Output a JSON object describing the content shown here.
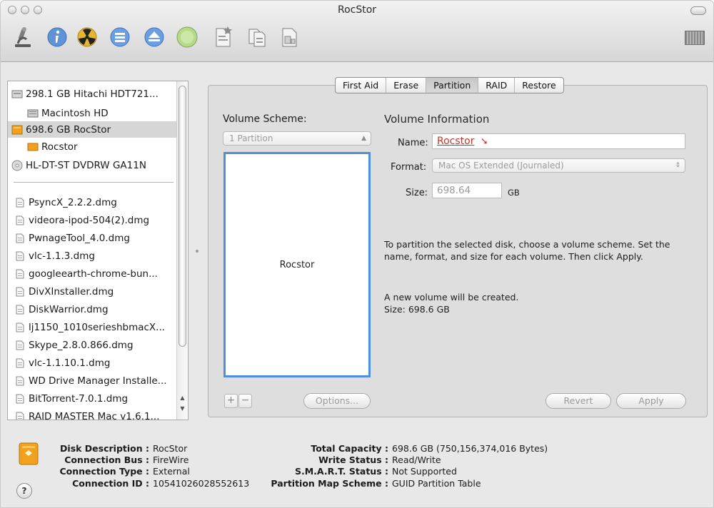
{
  "window": {
    "title": "RocStor"
  },
  "colors": {
    "selection_blue": "#4e8fdc",
    "name_red": "#c0392b",
    "disk_orange": "#f0a21f"
  },
  "toolbar": {
    "items": [
      {
        "name": "burn",
        "icon": "burn-icon"
      },
      {
        "name": "info",
        "icon": "info-icon"
      },
      {
        "name": "enable-journaling",
        "icon": "radiation-icon"
      },
      {
        "name": "mount",
        "icon": "mount-icon"
      },
      {
        "name": "eject",
        "icon": "eject-icon"
      },
      {
        "name": "enable-journaling-alt",
        "icon": "green-disc-icon"
      },
      {
        "name": "new-image",
        "icon": "new-image-icon"
      },
      {
        "name": "convert",
        "icon": "convert-icon"
      },
      {
        "name": "resize-image",
        "icon": "resize-image-icon"
      },
      {
        "name": "log",
        "icon": "log-icon"
      }
    ]
  },
  "sidebar": {
    "items": [
      {
        "label": "298.1 GB Hitachi HDT721...",
        "icon": "hard-disk-icon",
        "indent": 0
      },
      {
        "label": "Macintosh HD",
        "icon": "volume-icon",
        "indent": 1
      },
      {
        "label": "698.6 GB RocStor",
        "icon": "external-disk-icon",
        "indent": 0,
        "selected": true
      },
      {
        "label": "Rocstor",
        "icon": "external-volume-icon",
        "indent": 1
      },
      {
        "label": "HL-DT-ST DVDRW GA11N",
        "icon": "optical-drive-icon",
        "indent": 0
      },
      {
        "label": "PsyncX_2.2.2.dmg",
        "icon": "dmg-icon",
        "indent": 0
      },
      {
        "label": "videora-ipod-504(2).dmg",
        "icon": "dmg-icon",
        "indent": 0
      },
      {
        "label": "PwnageTool_4.0.dmg",
        "icon": "dmg-icon",
        "indent": 0
      },
      {
        "label": "vlc-1.1.3.dmg",
        "icon": "dmg-icon",
        "indent": 0
      },
      {
        "label": "googleearth-chrome-bun...",
        "icon": "dmg-icon",
        "indent": 0
      },
      {
        "label": "DivXInstaller.dmg",
        "icon": "dmg-icon",
        "indent": 0
      },
      {
        "label": "DiskWarrior.dmg",
        "icon": "dmg-icon",
        "indent": 0
      },
      {
        "label": "lj1150_1010serieshbmacX...",
        "icon": "dmg-icon",
        "indent": 0
      },
      {
        "label": "Skype_2.8.0.866.dmg",
        "icon": "dmg-icon",
        "indent": 0
      },
      {
        "label": "vlc-1.1.10.1.dmg",
        "icon": "dmg-icon",
        "indent": 0
      },
      {
        "label": "WD Drive Manager Installe...",
        "icon": "dmg-icon",
        "indent": 0
      },
      {
        "label": "BitTorrent-7.0.1.dmg",
        "icon": "dmg-icon",
        "indent": 0
      },
      {
        "label": "RAID MASTER Mac v1.6.1...",
        "icon": "dmg-icon",
        "indent": 0
      }
    ]
  },
  "tabs": [
    {
      "label": "First Aid"
    },
    {
      "label": "Erase"
    },
    {
      "label": "Partition",
      "active": true
    },
    {
      "label": "RAID"
    },
    {
      "label": "Restore"
    }
  ],
  "partition": {
    "scheme_label": "Volume Scheme:",
    "scheme_value": "1 Partition",
    "info_title": "Volume Information",
    "name_label": "Name:",
    "name_value": "Rocstor",
    "format_label": "Format:",
    "format_value": "Mac OS Extended (Journaled)",
    "size_label": "Size:",
    "size_value": "698.64",
    "size_unit": "GB",
    "map_label": "Rocstor",
    "instructions": "To partition the selected disk, choose a volume scheme. Set the name, format, and size for each volume. Then click Apply.",
    "note_line1": "A new volume will be created.",
    "note_line2": "Size: 698.6 GB",
    "add_label": "+",
    "remove_label": "−",
    "options_label": "Options...",
    "revert_label": "Revert",
    "apply_label": "Apply"
  },
  "footer": {
    "left": [
      {
        "label": "Disk Description :",
        "value": "RocStor"
      },
      {
        "label": "Connection Bus :",
        "value": "FireWire"
      },
      {
        "label": "Connection Type :",
        "value": "External"
      },
      {
        "label": "Connection ID :",
        "value": "10541026028552613"
      }
    ],
    "right": [
      {
        "label": "Total Capacity :",
        "value": "698.6 GB (750,156,374,016 Bytes)"
      },
      {
        "label": "Write Status :",
        "value": "Read/Write"
      },
      {
        "label": "S.M.A.R.T. Status :",
        "value": "Not Supported"
      },
      {
        "label": "Partition Map Scheme :",
        "value": "GUID Partition Table"
      }
    ],
    "help_label": "?"
  }
}
